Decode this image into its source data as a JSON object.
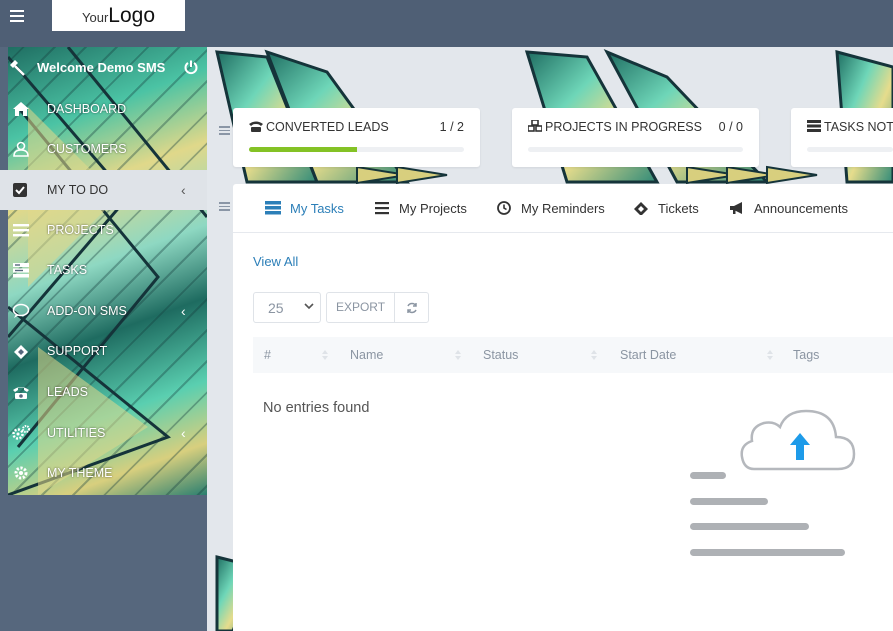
{
  "header": {
    "logo": {
      "prefix": "Your",
      "main": "Logo"
    }
  },
  "sidebar": {
    "welcome": "Welcome Demo SMS",
    "items": [
      {
        "label": "DASHBOARD",
        "icon": "home-icon"
      },
      {
        "label": "CUSTOMERS",
        "icon": "user-icon"
      },
      {
        "label": "MY TO DO",
        "icon": "checkbox-icon",
        "active": true,
        "expandable": true
      },
      {
        "label": "PROJECTS",
        "icon": "bars-icon"
      },
      {
        "label": "TASKS",
        "icon": "tasks-icon"
      },
      {
        "label": "ADD-ON SMS",
        "icon": "comment-icon",
        "expandable": true
      },
      {
        "label": "SUPPORT",
        "icon": "ticket-icon"
      },
      {
        "label": "LEADS",
        "icon": "phone-icon"
      },
      {
        "label": "UTILITIES",
        "icon": "cogs-icon",
        "expandable": true
      },
      {
        "label": "MY THEME",
        "icon": "gear-icon"
      }
    ]
  },
  "stats": [
    {
      "title": "CONVERTED LEADS",
      "value": "1 / 2",
      "progress": 0.5,
      "icon": "phone-icon"
    },
    {
      "title": "PROJECTS IN PROGRESS",
      "value": "0 / 0",
      "progress": 0,
      "icon": "cubes-icon"
    },
    {
      "title": "TASKS NOT",
      "value": "",
      "progress": 0,
      "icon": "tasks-icon"
    }
  ],
  "tabs": [
    {
      "label": "My Tasks",
      "icon": "tasks-icon",
      "active": true
    },
    {
      "label": "My Projects",
      "icon": "bars-icon"
    },
    {
      "label": "My Reminders",
      "icon": "clock-icon"
    },
    {
      "label": "Tickets",
      "icon": "ticket-icon"
    },
    {
      "label": "Announcements",
      "icon": "bullhorn-icon"
    }
  ],
  "table": {
    "view_all": "View All",
    "page_length": "25",
    "export_label": "EXPORT",
    "columns": [
      "#",
      "Name",
      "Status",
      "Start Date",
      "Tags"
    ],
    "empty_text": "No entries found"
  },
  "colors": {
    "topbar": "#4f5f75",
    "sidebar": "#56677d",
    "accent": "#2c7fb8",
    "progress": "#84c225",
    "upload_arrow": "#1e9be9"
  }
}
